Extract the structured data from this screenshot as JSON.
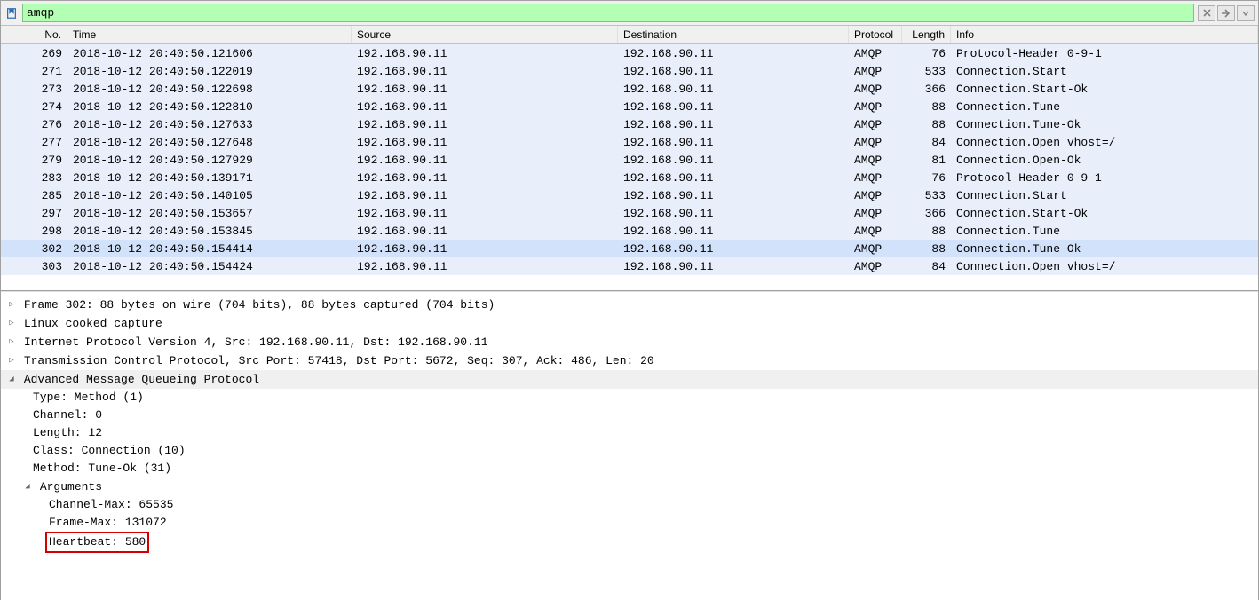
{
  "filter": {
    "value": "amqp"
  },
  "columns": {
    "no": "No.",
    "time": "Time",
    "src": "Source",
    "dst": "Destination",
    "proto": "Protocol",
    "len": "Length",
    "info": "Info"
  },
  "packets": [
    {
      "no": "269",
      "time": "2018-10-12 20:40:50.121606",
      "src": "192.168.90.11",
      "dst": "192.168.90.11",
      "proto": "AMQP",
      "len": "76",
      "info": "Protocol-Header 0-9-1"
    },
    {
      "no": "271",
      "time": "2018-10-12 20:40:50.122019",
      "src": "192.168.90.11",
      "dst": "192.168.90.11",
      "proto": "AMQP",
      "len": "533",
      "info": "Connection.Start"
    },
    {
      "no": "273",
      "time": "2018-10-12 20:40:50.122698",
      "src": "192.168.90.11",
      "dst": "192.168.90.11",
      "proto": "AMQP",
      "len": "366",
      "info": "Connection.Start-Ok"
    },
    {
      "no": "274",
      "time": "2018-10-12 20:40:50.122810",
      "src": "192.168.90.11",
      "dst": "192.168.90.11",
      "proto": "AMQP",
      "len": "88",
      "info": "Connection.Tune"
    },
    {
      "no": "276",
      "time": "2018-10-12 20:40:50.127633",
      "src": "192.168.90.11",
      "dst": "192.168.90.11",
      "proto": "AMQP",
      "len": "88",
      "info": "Connection.Tune-Ok"
    },
    {
      "no": "277",
      "time": "2018-10-12 20:40:50.127648",
      "src": "192.168.90.11",
      "dst": "192.168.90.11",
      "proto": "AMQP",
      "len": "84",
      "info": "Connection.Open vhost=/"
    },
    {
      "no": "279",
      "time": "2018-10-12 20:40:50.127929",
      "src": "192.168.90.11",
      "dst": "192.168.90.11",
      "proto": "AMQP",
      "len": "81",
      "info": "Connection.Open-Ok"
    },
    {
      "no": "283",
      "time": "2018-10-12 20:40:50.139171",
      "src": "192.168.90.11",
      "dst": "192.168.90.11",
      "proto": "AMQP",
      "len": "76",
      "info": "Protocol-Header 0-9-1"
    },
    {
      "no": "285",
      "time": "2018-10-12 20:40:50.140105",
      "src": "192.168.90.11",
      "dst": "192.168.90.11",
      "proto": "AMQP",
      "len": "533",
      "info": "Connection.Start"
    },
    {
      "no": "297",
      "time": "2018-10-12 20:40:50.153657",
      "src": "192.168.90.11",
      "dst": "192.168.90.11",
      "proto": "AMQP",
      "len": "366",
      "info": "Connection.Start-Ok"
    },
    {
      "no": "298",
      "time": "2018-10-12 20:40:50.153845",
      "src": "192.168.90.11",
      "dst": "192.168.90.11",
      "proto": "AMQP",
      "len": "88",
      "info": "Connection.Tune"
    },
    {
      "no": "302",
      "time": "2018-10-12 20:40:50.154414",
      "src": "192.168.90.11",
      "dst": "192.168.90.11",
      "proto": "AMQP",
      "len": "88",
      "info": "Connection.Tune-Ok",
      "selected": true
    },
    {
      "no": "303",
      "time": "2018-10-12 20:40:50.154424",
      "src": "192.168.90.11",
      "dst": "192.168.90.11",
      "proto": "AMQP",
      "len": "84",
      "info": "Connection.Open vhost=/"
    }
  ],
  "details": {
    "frame": "Frame 302: 88 bytes on wire (704 bits), 88 bytes captured (704 bits)",
    "linux": "Linux cooked capture",
    "ip": "Internet Protocol Version 4, Src: 192.168.90.11, Dst: 192.168.90.11",
    "tcp": "Transmission Control Protocol, Src Port: 57418, Dst Port: 5672, Seq: 307, Ack: 486, Len: 20",
    "amqp": "Advanced Message Queueing Protocol",
    "type": "Type: Method (1)",
    "channel": "Channel: 0",
    "length": "Length: 12",
    "class": "Class: Connection (10)",
    "method": "Method: Tune-Ok (31)",
    "args": "Arguments",
    "chmax": "Channel-Max: 65535",
    "frmax": "Frame-Max: 131072",
    "heartbeat": "Heartbeat: 580"
  }
}
